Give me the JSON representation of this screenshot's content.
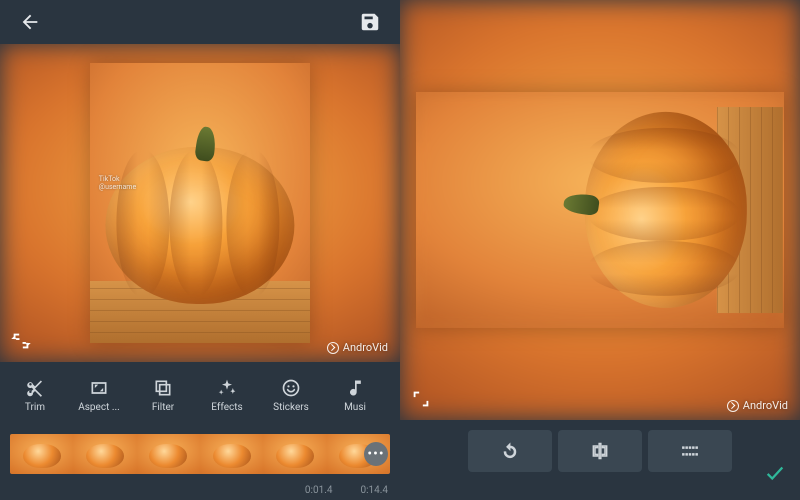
{
  "header": {
    "back": "Back",
    "save": "Save"
  },
  "watermark": {
    "text": "AndroVid"
  },
  "preview_left": {
    "tiktok_label": "TikTok",
    "tiktok_user": "@username"
  },
  "tools": [
    {
      "label": "Trim",
      "icon": "scissors-icon"
    },
    {
      "label": "Aspect ...",
      "icon": "aspect-icon"
    },
    {
      "label": "Filter",
      "icon": "filter-icon"
    },
    {
      "label": "Effects",
      "icon": "effects-icon"
    },
    {
      "label": "Stickers",
      "icon": "stickers-icon"
    },
    {
      "label": "Musi",
      "icon": "music-icon"
    }
  ],
  "timeline": {
    "thumb_count": 6,
    "more": "•••",
    "current_time": "0:01.4",
    "total_time": "0:14.4"
  },
  "right_actions": {
    "rotate": "Rotate",
    "flip": "Flip",
    "crop": "Crop",
    "confirm": "Confirm"
  }
}
